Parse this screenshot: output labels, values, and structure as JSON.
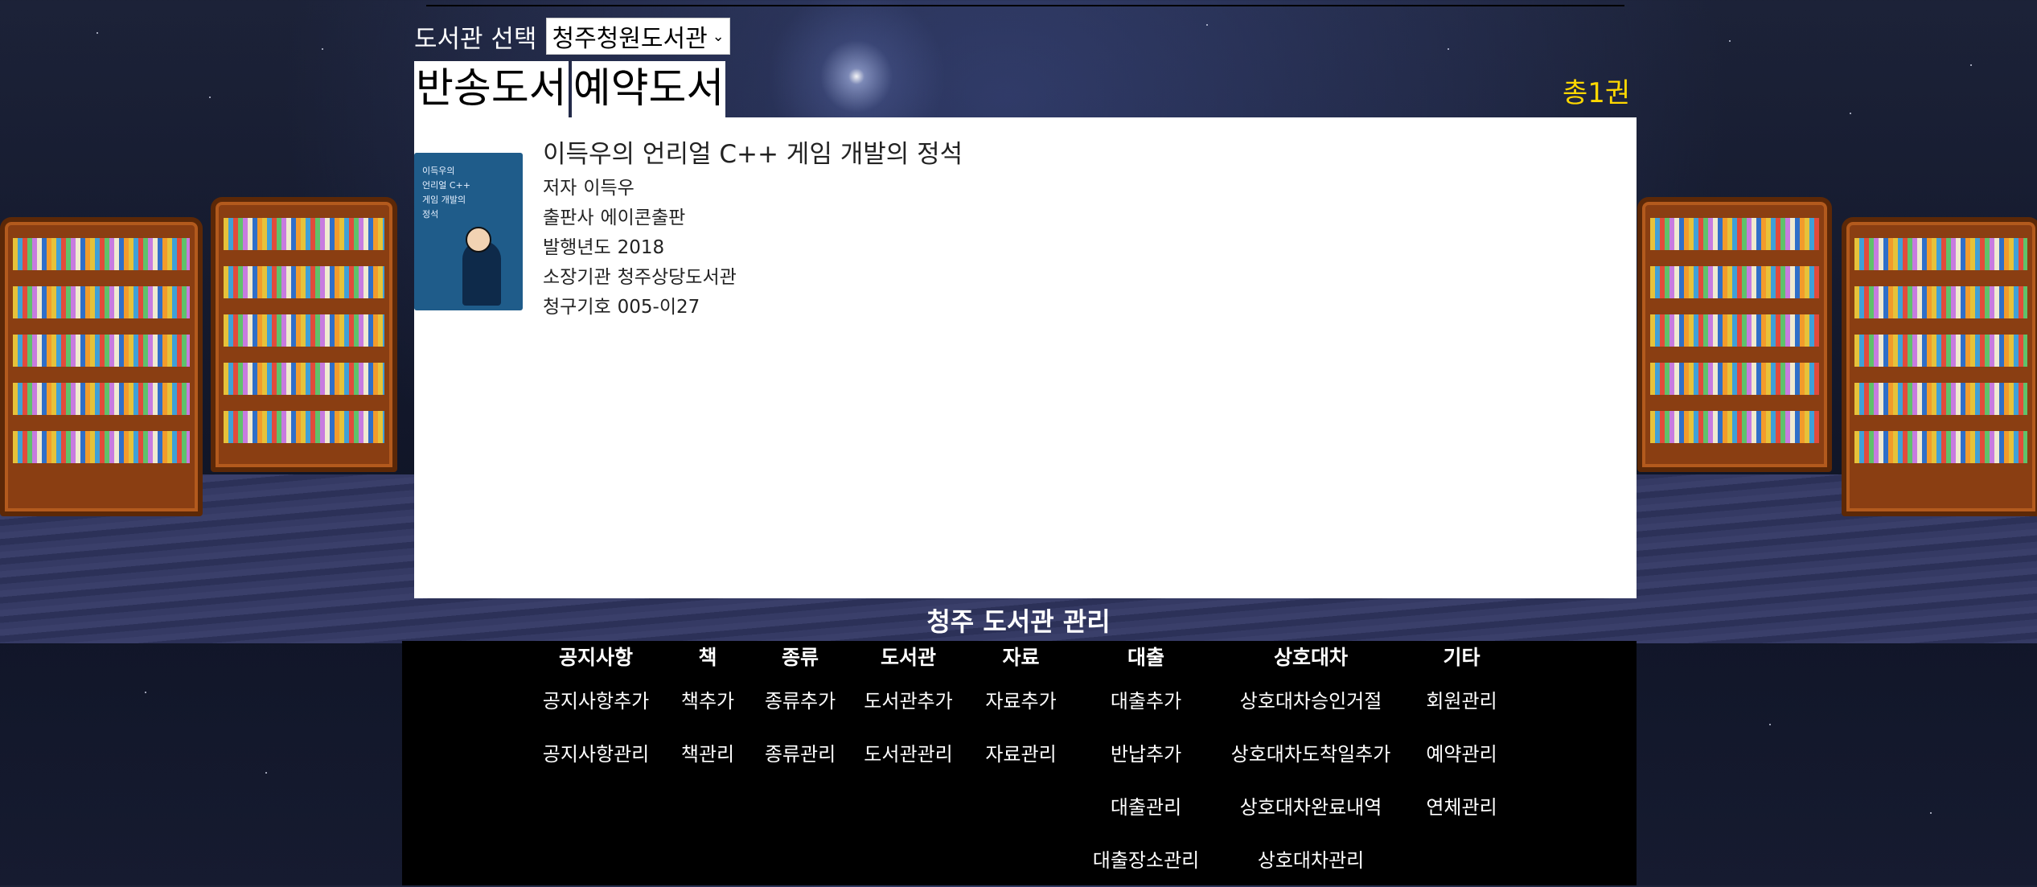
{
  "library_select": {
    "label": "도서관 선택",
    "selected": "청주청원도서관"
  },
  "tabs": [
    "반송도서",
    "예약도서"
  ],
  "total": "총1권",
  "book": {
    "title": "이득우의 언리얼 C++ 게임 개발의 정석",
    "cover_text": [
      "이득우의",
      "언리얼 C++",
      "게임 개발의",
      "정석"
    ],
    "author": {
      "label": "저자",
      "value": "이득우"
    },
    "publisher": {
      "label": "출판사",
      "value": "에이콘출판"
    },
    "year": {
      "label": "발행년도",
      "value": "2018"
    },
    "holding": {
      "label": "소장기관",
      "value": "청주상당도서관"
    },
    "call_no": {
      "label": "청구기호",
      "value": "005-이27"
    }
  },
  "admin": {
    "title": "청주 도서관 관리",
    "columns": [
      {
        "head": "공지사항",
        "items": [
          "공지사항추가",
          "공지사항관리"
        ]
      },
      {
        "head": "책",
        "items": [
          "책추가",
          "책관리"
        ]
      },
      {
        "head": "종류",
        "items": [
          "종류추가",
          "종류관리"
        ]
      },
      {
        "head": "도서관",
        "items": [
          "도서관추가",
          "도서관관리"
        ]
      },
      {
        "head": "자료",
        "items": [
          "자료추가",
          "자료관리"
        ]
      },
      {
        "head": "대출",
        "items": [
          "대출추가",
          "반납추가",
          "대출관리",
          "대출장소관리"
        ]
      },
      {
        "head": "상호대차",
        "items": [
          "상호대차승인거절",
          "상호대차도착일추가",
          "상호대차완료내역",
          "상호대차관리"
        ]
      },
      {
        "head": "기타",
        "items": [
          "회원관리",
          "예약관리",
          "연체관리"
        ]
      }
    ]
  },
  "colors": {
    "total": "#ffd800",
    "panel": "#ffffff",
    "admin_bg": "#000000"
  }
}
